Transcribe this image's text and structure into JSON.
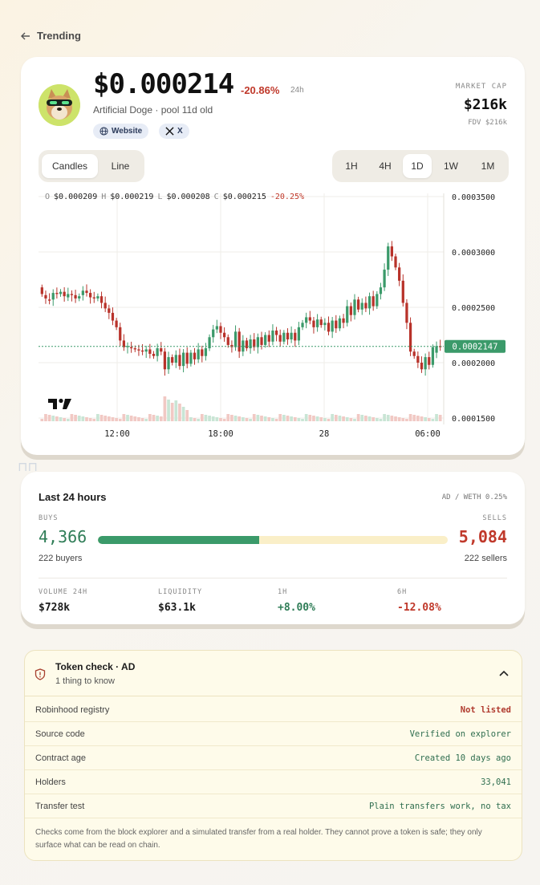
{
  "nav": {
    "back_label": "Trending"
  },
  "token": {
    "price": "$0.000214",
    "change": "-20.86%",
    "change_period": "24h",
    "name_line": "Artificial Doge · pool 11d old",
    "links": [
      {
        "label": "Website",
        "icon": "globe-icon"
      },
      {
        "label": "X",
        "icon": "x-logo-icon"
      }
    ],
    "market_cap_label": "MARKET CAP",
    "market_cap": "$216k",
    "fdv": "FDV $216k"
  },
  "chart_controls": {
    "modes": [
      "Candles",
      "Line"
    ],
    "active_mode": "Candles",
    "timeframes": [
      "1H",
      "4H",
      "1D",
      "1W",
      "1M"
    ],
    "active_timeframe": "1D"
  },
  "chart_data": {
    "type": "candlestick",
    "ohlc_legend": {
      "o_label": "O",
      "o": "$0.000209",
      "h_label": "H",
      "h": "$0.000219",
      "l_label": "L",
      "l": "$0.000208",
      "c_label": "C",
      "c": "$0.000215",
      "change": "-20.25%"
    },
    "y_ticks": [
      "0.0003500",
      "0.0003000",
      "0.0002500",
      "0.0002000",
      "0.0001500"
    ],
    "y_range": [
      0.00015,
      0.00035
    ],
    "x_ticks": [
      "12:00",
      "18:00",
      "28",
      "06:00"
    ],
    "last_price_label": "0.0002147",
    "last_price": 0.0002147,
    "candles": [
      [
        0.000268,
        0.000262
      ],
      [
        0.000261,
        0.000258
      ],
      [
        0.000257,
        0.000256
      ],
      [
        0.000257,
        0.000263
      ],
      [
        0.000263,
        0.000262
      ],
      [
        0.000262,
        0.000264
      ],
      [
        0.000264,
        0.00026
      ],
      [
        0.000259,
        0.000262
      ],
      [
        0.000262,
        0.000261
      ],
      [
        0.000261,
        0.000258
      ],
      [
        0.000258,
        0.00026
      ],
      [
        0.000261,
        0.000265
      ],
      [
        0.000265,
        0.000263
      ],
      [
        0.000263,
        0.000259
      ],
      [
        0.000259,
        0.000258
      ],
      [
        0.000258,
        0.00026
      ],
      [
        0.00026,
        0.000254
      ],
      [
        0.000254,
        0.000249
      ],
      [
        0.000249,
        0.000245
      ],
      [
        0.000245,
        0.000238
      ],
      [
        0.000238,
        0.000232
      ],
      [
        0.000232,
        0.00022
      ],
      [
        0.00022,
        0.000214
      ],
      [
        0.000214,
        0.000215
      ],
      [
        0.000214,
        0.000213
      ],
      [
        0.000213,
        0.000212
      ],
      [
        0.000212,
        0.000211
      ],
      [
        0.000211,
        0.00021
      ],
      [
        0.00021,
        0.000212
      ],
      [
        0.000212,
        0.000208
      ],
      [
        0.000208,
        0.000206
      ],
      [
        0.000206,
        0.000213
      ],
      [
        0.000213,
        0.00021
      ],
      [
        0.00021,
        0.000194
      ],
      [
        0.000194,
        0.000205
      ],
      [
        0.000205,
        0.0002
      ],
      [
        0.0002,
        0.000207
      ],
      [
        0.000207,
        0.000197
      ],
      [
        0.000197,
        0.000209
      ],
      [
        0.000209,
        0.000199
      ],
      [
        0.000199,
        0.000209
      ],
      [
        0.000209,
        0.000203
      ],
      [
        0.000203,
        0.000212
      ],
      [
        0.000212,
        0.000206
      ],
      [
        0.000206,
        0.000213
      ],
      [
        0.000213,
        0.000223
      ],
      [
        0.000223,
        0.00023
      ],
      [
        0.00023,
        0.000233
      ],
      [
        0.000233,
        0.000227
      ],
      [
        0.000227,
        0.000223
      ],
      [
        0.000223,
        0.000216
      ],
      [
        0.000216,
        0.000214
      ],
      [
        0.000214,
        0.000228
      ],
      [
        0.000228,
        0.00021
      ],
      [
        0.00021,
        0.00022
      ],
      [
        0.00022,
        0.000213
      ],
      [
        0.000213,
        0.000221
      ],
      [
        0.000221,
        0.000214
      ],
      [
        0.000214,
        0.000223
      ],
      [
        0.000223,
        0.000216
      ],
      [
        0.000216,
        0.000225
      ],
      [
        0.000225,
        0.000219
      ],
      [
        0.000219,
        0.000229
      ],
      [
        0.000229,
        0.000225
      ],
      [
        0.000225,
        0.000219
      ],
      [
        0.000219,
        0.000227
      ],
      [
        0.000227,
        0.000221
      ],
      [
        0.000221,
        0.000227
      ],
      [
        0.000227,
        0.00022
      ],
      [
        0.00022,
        0.000232
      ],
      [
        0.000232,
        0.000236
      ],
      [
        0.000236,
        0.000241
      ],
      [
        0.000241,
        0.000238
      ],
      [
        0.000238,
        0.000232
      ],
      [
        0.000232,
        0.000239
      ],
      [
        0.000239,
        0.000234
      ],
      [
        0.000234,
        0.000236
      ],
      [
        0.000236,
        0.000228
      ],
      [
        0.000228,
        0.000238
      ],
      [
        0.000238,
        0.000231
      ],
      [
        0.000231,
        0.00024
      ],
      [
        0.00024,
        0.000236
      ],
      [
        0.000236,
        0.000251
      ],
      [
        0.000251,
        0.000243
      ],
      [
        0.000243,
        0.000257
      ],
      [
        0.000257,
        0.000248
      ],
      [
        0.000248,
        0.000254
      ],
      [
        0.000254,
        0.000249
      ],
      [
        0.000249,
        0.00026
      ],
      [
        0.00026,
        0.000251
      ],
      [
        0.000251,
        0.000262
      ],
      [
        0.000262,
        0.000268
      ],
      [
        0.000268,
        0.000284
      ],
      [
        0.000284,
        0.000305
      ],
      [
        0.000305,
        0.000296
      ],
      [
        0.000296,
        0.000286
      ],
      [
        0.000286,
        0.000274
      ],
      [
        0.000274,
        0.000254
      ],
      [
        0.000254,
        0.000236
      ],
      [
        0.000236,
        0.00021
      ],
      [
        0.00021,
        0.000206
      ],
      [
        0.000206,
        0.0002
      ],
      [
        0.0002,
        0.000194
      ],
      [
        0.000194,
        0.000205
      ],
      [
        0.000205,
        0.000198
      ],
      [
        0.000198,
        0.000214
      ],
      [
        0.000209,
        0.000215
      ],
      [
        0.000215,
        0.000214
      ]
    ]
  },
  "last24": {
    "title": "Last 24 hours",
    "pair": "AD / WETH 0.25%",
    "buys_label": "BUYS",
    "buys": "4,366",
    "buyers": "222 buyers",
    "sells_label": "SELLS",
    "sells": "5,084",
    "sellers": "222 sellers",
    "buy_share": 0.462,
    "stats": [
      {
        "label": "VOLUME 24H",
        "value": "$728k"
      },
      {
        "label": "LIQUIDITY",
        "value": "$63.1k"
      },
      {
        "label": "1H",
        "value": "+8.00%"
      },
      {
        "label": "6H",
        "value": "-12.08%"
      }
    ]
  },
  "token_check": {
    "title": "Token check · AD",
    "subtitle": "1 thing to know",
    "rows": [
      {
        "label": "Robinhood registry",
        "value": "Not listed"
      },
      {
        "label": "Source code",
        "value": "Verified on explorer"
      },
      {
        "label": "Contract age",
        "value": "Created 10 days ago"
      },
      {
        "label": "Holders",
        "value": "33,041"
      },
      {
        "label": "Transfer test",
        "value": "Plain transfers work, no tax"
      }
    ],
    "note": "Checks come from the block explorer and a simulated transfer from a real holder. They cannot prove a token is safe; they only surface what can be read on chain."
  },
  "colors": {
    "up": "#3b9a6a",
    "down": "#b8322a",
    "accent_green": "#2f7d57",
    "accent_red": "#c0392b"
  }
}
